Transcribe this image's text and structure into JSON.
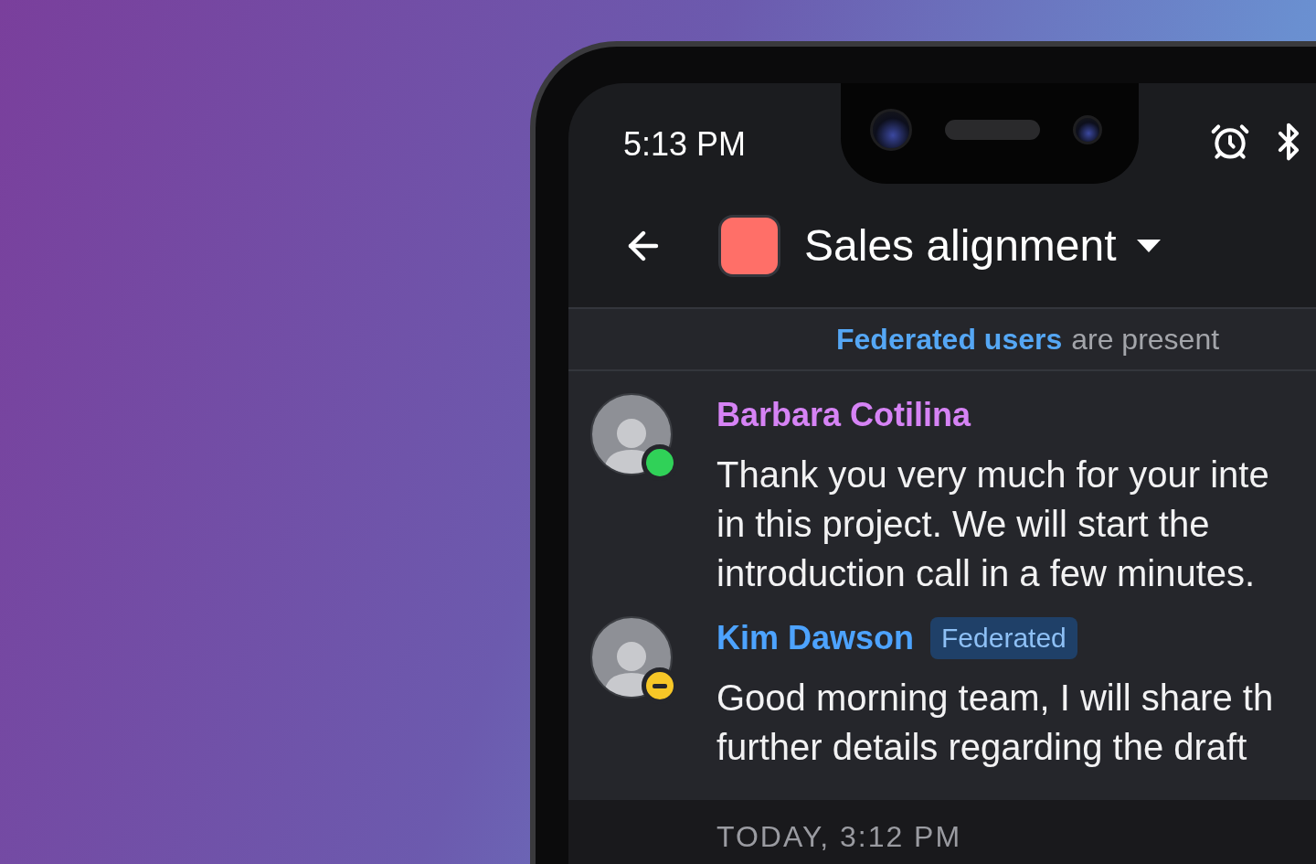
{
  "status_bar": {
    "time": "5:13 PM"
  },
  "header": {
    "title": "Sales alignment"
  },
  "banner": {
    "link": "Federated users",
    "text": "are present"
  },
  "messages": [
    {
      "author": "Barbara Cotilina",
      "color": "#d683f5",
      "status": {
        "kind": "online",
        "color": "#30d158"
      },
      "lines": [
        "Thank you very much for your inte",
        "in this project. We will start the",
        "introduction call in a few minutes."
      ]
    },
    {
      "author": "Kim Dawson",
      "color": "#4da3ff",
      "badge": "Federated",
      "status": {
        "kind": "busy",
        "color": "#f7c727"
      },
      "lines": [
        "Good morning team, I will share th",
        "further details regarding the draft"
      ]
    }
  ],
  "timestamp": "TODAY, 3:12 PM"
}
